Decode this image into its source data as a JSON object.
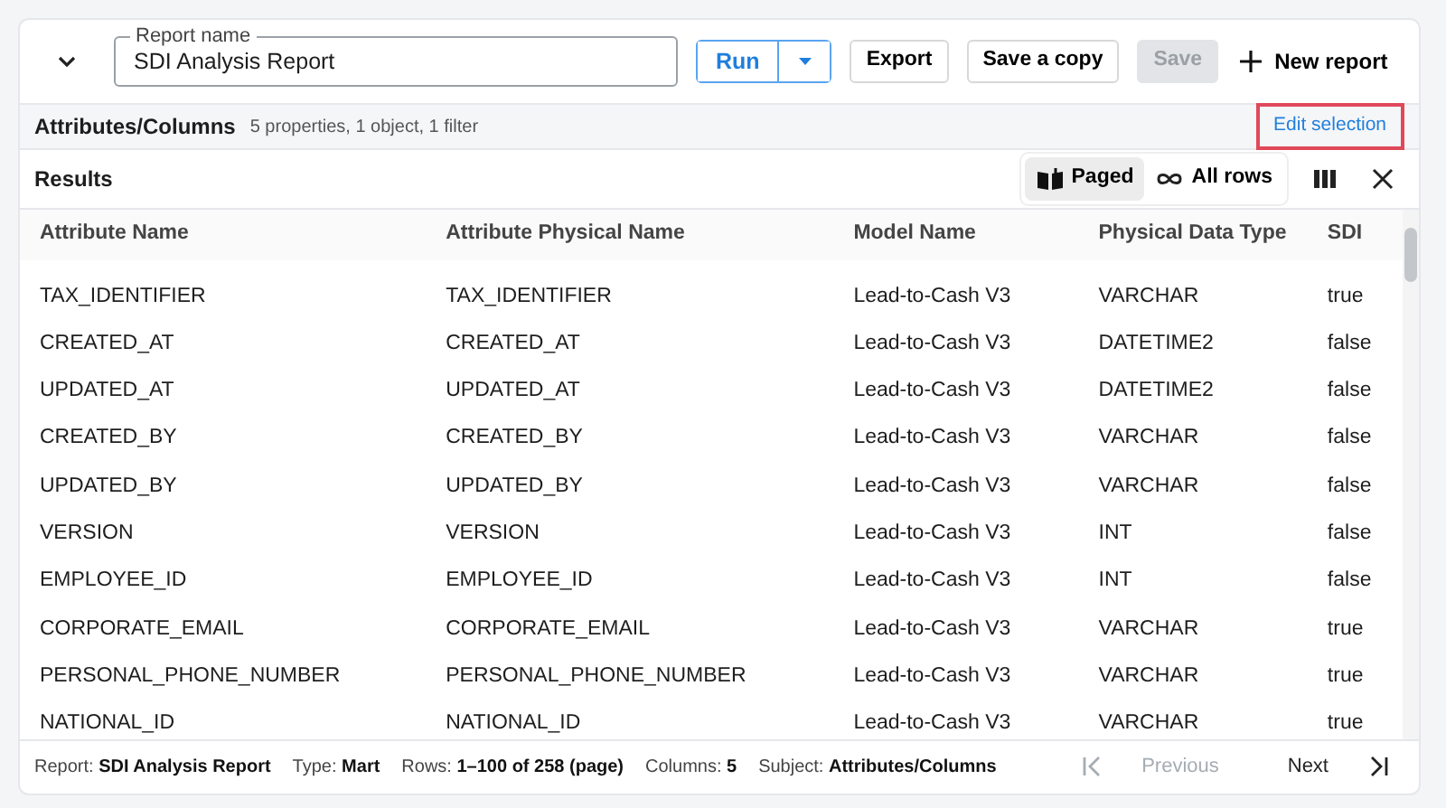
{
  "toolbar": {
    "report_name_label": "Report name",
    "report_name": "SDI Analysis Report",
    "run": "Run",
    "export": "Export",
    "save_copy": "Save a copy",
    "save": {
      "label": "Save",
      "disabled": true
    },
    "new_report": "New report"
  },
  "selection_bar": {
    "title": "Attributes/Columns",
    "summary": "5 properties, 1 object, 1 filter",
    "edit_link": {
      "label": "Edit selection",
      "highlighted": true
    }
  },
  "results": {
    "title": "Results",
    "modes": [
      {
        "label": "Paged",
        "kind": "book",
        "selected": true
      },
      {
        "label": "All rows",
        "kind": "infinity",
        "selected": false
      }
    ]
  },
  "table": {
    "columns": [
      "Attribute Name",
      "Attribute Physical Name",
      "Model Name",
      "Physical Data Type",
      "SDI"
    ],
    "rows": [
      [
        "TAX_IDENTIFIER",
        "TAX_IDENTIFIER",
        "Lead-to-Cash V3",
        "VARCHAR",
        "true"
      ],
      [
        "CREATED_AT",
        "CREATED_AT",
        "Lead-to-Cash V3",
        "DATETIME2",
        "false"
      ],
      [
        "UPDATED_AT",
        "UPDATED_AT",
        "Lead-to-Cash V3",
        "DATETIME2",
        "false"
      ],
      [
        "CREATED_BY",
        "CREATED_BY",
        "Lead-to-Cash V3",
        "VARCHAR",
        "false"
      ],
      [
        "UPDATED_BY",
        "UPDATED_BY",
        "Lead-to-Cash V3",
        "VARCHAR",
        "false"
      ],
      [
        "VERSION",
        "VERSION",
        "Lead-to-Cash V3",
        "INT",
        "false"
      ],
      [
        "EMPLOYEE_ID",
        "EMPLOYEE_ID",
        "Lead-to-Cash V3",
        "INT",
        "false"
      ],
      [
        "CORPORATE_EMAIL",
        "CORPORATE_EMAIL",
        "Lead-to-Cash V3",
        "VARCHAR",
        "true"
      ],
      [
        "PERSONAL_PHONE_NUMBER",
        "PERSONAL_PHONE_NUMBER",
        "Lead-to-Cash V3",
        "VARCHAR",
        "true"
      ],
      [
        "NATIONAL_ID",
        "NATIONAL_ID",
        "Lead-to-Cash V3",
        "VARCHAR",
        "true"
      ]
    ]
  },
  "status_bar": {
    "items": [
      {
        "label": "Report:",
        "value": "SDI Analysis Report"
      },
      {
        "label": "Type:",
        "value": "Mart"
      },
      {
        "label": "Rows:",
        "value": "1–100 of 258 (page)"
      },
      {
        "label": "Columns:",
        "value": "5"
      },
      {
        "label": "Subject:",
        "value": "Attributes/Columns"
      }
    ],
    "pager": {
      "previous": {
        "label": "Previous",
        "disabled": true
      },
      "next": {
        "label": "Next",
        "disabled": false
      },
      "first_disabled": true,
      "last_disabled": false
    }
  }
}
